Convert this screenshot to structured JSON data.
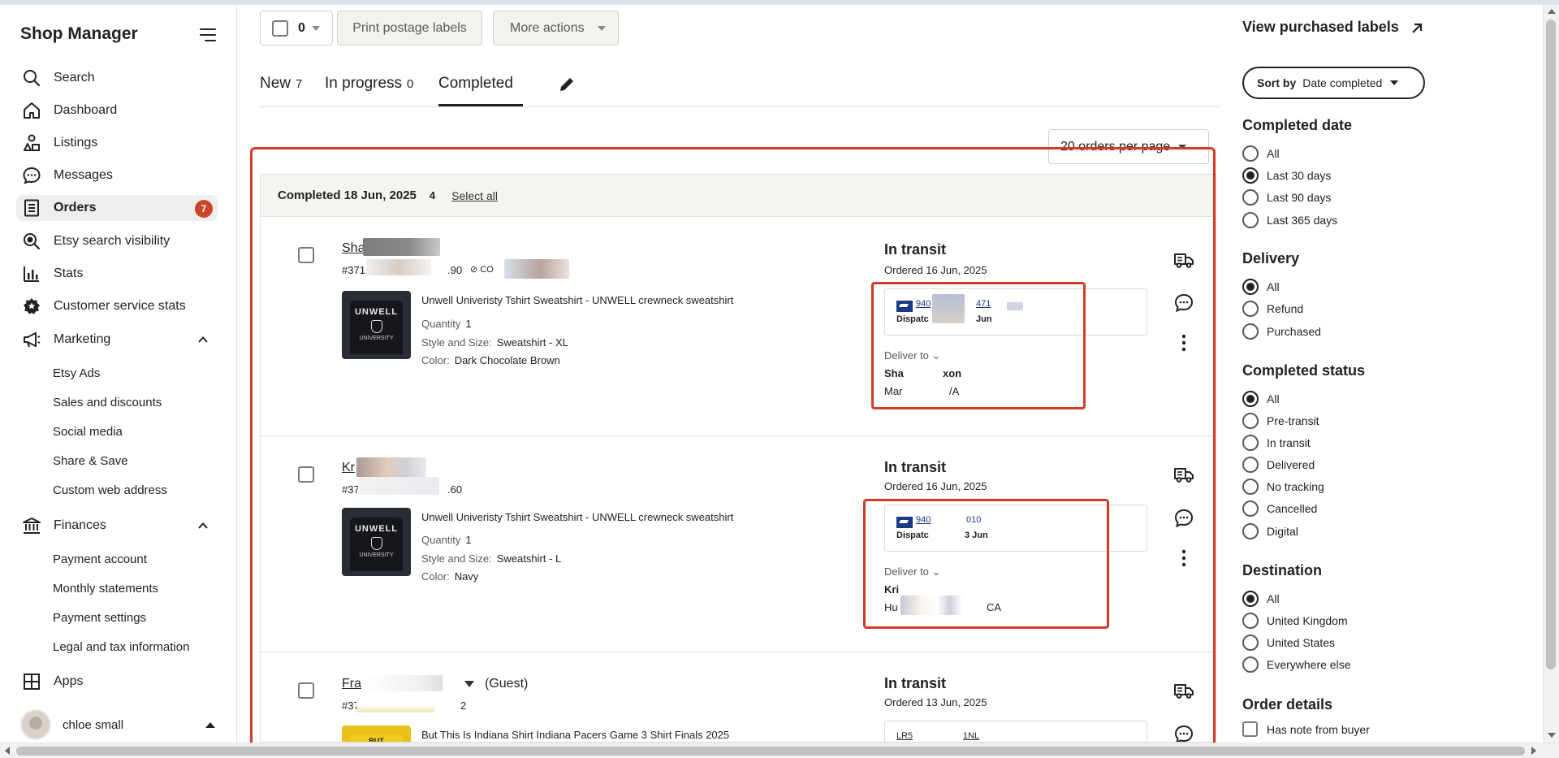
{
  "app": {
    "title": "Shop Manager"
  },
  "sidebar": {
    "items": [
      {
        "label": "Search",
        "icon": "search-icon"
      },
      {
        "label": "Dashboard",
        "icon": "home-icon"
      },
      {
        "label": "Listings",
        "icon": "listings-icon"
      },
      {
        "label": "Messages",
        "icon": "messages-icon"
      },
      {
        "label": "Orders",
        "icon": "orders-icon",
        "badge": "7",
        "active": true
      },
      {
        "label": "Etsy search visibility",
        "icon": "search-visibility-icon"
      },
      {
        "label": "Stats",
        "icon": "stats-icon"
      },
      {
        "label": "Customer service stats",
        "icon": "customer-service-icon"
      },
      {
        "label": "Marketing",
        "icon": "megaphone-icon"
      }
    ],
    "marketing_sub": [
      "Etsy Ads",
      "Sales and discounts",
      "Social media",
      "Share & Save",
      "Custom web address"
    ],
    "finances": {
      "label": "Finances",
      "icon": "bank-icon"
    },
    "finances_sub": [
      "Payment account",
      "Monthly statements",
      "Payment settings",
      "Legal and tax information"
    ],
    "apps": {
      "label": "Apps",
      "icon": "apps-icon"
    },
    "user": {
      "name": "chloe small"
    }
  },
  "toolbar": {
    "select_count": "0",
    "print_label": "Print postage labels",
    "more_actions": "More actions"
  },
  "tabs": [
    {
      "label": "New",
      "count": "7"
    },
    {
      "label": "In progress",
      "count": "0"
    },
    {
      "label": "Completed",
      "count": ""
    }
  ],
  "per_page": "20 orders per page",
  "group": {
    "title": "Completed 18 Jun, 2025",
    "count": "4",
    "select_all": "Select all"
  },
  "orders": [
    {
      "buyer": "Sha",
      "order_no_prefix": "#371",
      "order_no_suffix": ".90",
      "item_title": "Unwell Univeristy Tshirt Sweatshirt - UNWELL crewneck sweatshirt",
      "quantity_label": "Quantity",
      "quantity": "1",
      "style_label": "Style and Size:",
      "style": "Sweatshirt - XL",
      "color_label": "Color:",
      "color": "Dark Chocolate Brown",
      "status": "In transit",
      "ordered": "Ordered 16 Jun, 2025",
      "tracking_no": "940",
      "tracking_no_tail": "471",
      "dispatch": "Dispatc",
      "dispatch_tail": "Jun",
      "deliver_to": "Deliver to",
      "ship_name": "Sha",
      "ship_name_tail": "xon",
      "ship_addr": "Mar",
      "ship_addr_tail": "/A"
    },
    {
      "buyer": "Kr",
      "order_no_prefix": "#37",
      "order_no_suffix": ".60",
      "item_title": "Unwell Univeristy Tshirt Sweatshirt - UNWELL crewneck sweatshirt",
      "quantity_label": "Quantity",
      "quantity": "1",
      "style_label": "Style and Size:",
      "style": "Sweatshirt - L",
      "color_label": "Color:",
      "color": "Navy",
      "status": "In transit",
      "ordered": "Ordered 16 Jun, 2025",
      "tracking_no": "940",
      "tracking_no_tail": "010",
      "dispatch": "Dispatc",
      "dispatch_tail": "3 Jun",
      "deliver_to": "Deliver to",
      "ship_name": "Kri",
      "ship_addr": "Hu",
      "ship_addr_tail": "CA"
    },
    {
      "buyer": "Fra",
      "guest": "(Guest)",
      "order_no_prefix": "#37",
      "order_no_suffix": "2",
      "item_title": "But This Is Indiana Shirt Indiana Pacers Game 3 Shirt Finals 2025",
      "status": "In transit",
      "ordered": "Ordered 13 Jun, 2025",
      "tracking_no": "LR5",
      "tracking_no_tail": "1NL"
    }
  ],
  "filters": {
    "view_purchased": "View purchased labels",
    "sort_key": "Sort by",
    "sort_value": "Date completed",
    "completed_date": {
      "title": "Completed date",
      "options": [
        "All",
        "Last 30 days",
        "Last 90 days",
        "Last 365 days"
      ],
      "selected": 1
    },
    "delivery": {
      "title": "Delivery",
      "options": [
        "All",
        "Refund",
        "Purchased"
      ],
      "selected": 0
    },
    "completed_status": {
      "title": "Completed status",
      "options": [
        "All",
        "Pre-transit",
        "In transit",
        "Delivered",
        "No tracking",
        "Cancelled",
        "Digital"
      ],
      "selected": 0
    },
    "destination": {
      "title": "Destination",
      "options": [
        "All",
        "United Kingdom",
        "United States",
        "Everywhere else"
      ],
      "selected": 0
    },
    "order_details": {
      "title": "Order details",
      "has_note": "Has note from buyer"
    }
  },
  "colors": {
    "accent_red": "#d23b26",
    "badge": "#cc4527",
    "usps_blue": "#1a3a85"
  }
}
